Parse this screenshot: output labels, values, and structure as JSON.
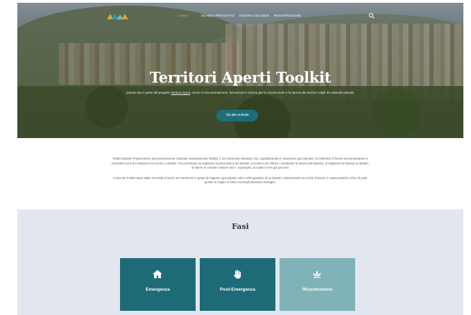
{
  "nav": {
    "logo_icon": "territori-aperti-logo",
    "items": [
      {
        "label": "Home",
        "active": true
      },
      {
        "label": "Scheda progetto",
        "active": false
      },
      {
        "label": "Ricerca schede",
        "active": false
      },
      {
        "label": "Registrazione",
        "active": false
      }
    ],
    "search_icon": "search-icon",
    "active_color": "#e0a13a"
  },
  "hero": {
    "title": "Territori Aperti Toolkit",
    "subtitle_before": "Questo sito è parte del progetto ",
    "subtitle_link": "Territori Aperti",
    "subtitle_after": ", centro di documentazione, formazione e ricerca per la ricostruzione e la ripresa dei territori colpiti da calamità naturali.",
    "button_label": "Vai alle schede",
    "button_color": "#1d6e79"
  },
  "intro": {
    "paragraphs": [
      "Toolkit Disaster Preparedness (successivamente chiamato semplicemente Toolkit), è uno strumento dinamico che, capitalizzando le esperienze già maturate, ha l'obiettivo di fornire raccomandazioni e procedure ad enti e istituzioni ma anche a cittadini, che permettano di migliorare la prevenzione dei disastri, di rendere più efficaci e strutturate le azioni post-disastro, di migliorare la risposta ai disastri, di ridurre la criticità in tutte le fasi e, soprattutto, di evitare errori già percorsi.",
      "L'idea del Toolkit nasce dalla necessità di avere uno strumento in grado di mappare ogni aspetto critico nella gestione di un disastro, selezionando una serie di buone e cattive pratiche al fine di poter gestire al meglio in futuro eventuali situazioni analoghe."
    ]
  },
  "fasi": {
    "title": "Fasi",
    "cards": [
      {
        "label": "Emergenza",
        "icon": "home-icon",
        "color": "#1d6b77"
      },
      {
        "label": "Post-Emergenza",
        "icon": "hand-icon",
        "color": "#1d6b77"
      },
      {
        "label": "Ricostruzione",
        "icon": "lotus-icon",
        "color": "#7fb3b8"
      }
    ]
  }
}
